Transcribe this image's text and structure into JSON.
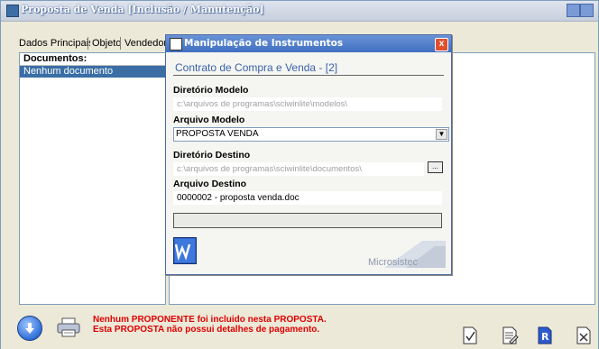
{
  "window": {
    "title": "Proposta de Venda [Inclusão / Manutenção]"
  },
  "tabs": [
    {
      "label": "Dados Principais"
    },
    {
      "label": "Objeto"
    },
    {
      "label": "Vendedor("
    }
  ],
  "documents": {
    "header": "Documentos:",
    "items": [
      "Nenhum documento"
    ]
  },
  "bottom": {
    "warning_line1": "Nenhum PROPONENTE foi incluido nesta PROPOSTA.",
    "warning_line2": "Esta PROPOSTA não possui detalhes de pagamento."
  },
  "modal": {
    "title": "Manipulação de Instrumentos",
    "heading": "Contrato de Compra e Venda - [2]",
    "model_dir_label": "Diretório Modelo",
    "model_dir_value": "c:\\arquivos de programas\\sciwinlite\\modelos\\",
    "model_file_label": "Arquivo Modelo",
    "model_file_value": "PROPOSTA VENDA",
    "dest_dir_label": "Diretório Destino",
    "dest_dir_value": "c:\\arquivos de programas\\sciwinlite\\documentos\\",
    "dest_file_label": "Arquivo Destino",
    "dest_file_value": "0000002 - proposta venda.doc",
    "browse_label": "...",
    "close_label": "x",
    "logo_text": "Microsistec"
  },
  "icons": {
    "accent": "#3b6ea5",
    "warning_color": "#e00000",
    "title_bar_color": "#4b6aa5"
  }
}
